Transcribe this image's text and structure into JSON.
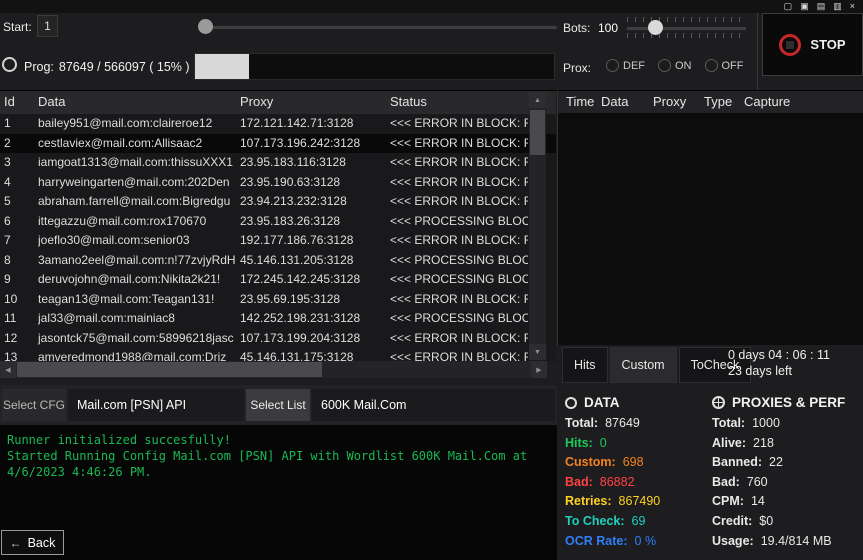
{
  "titlebar": {
    "icons": [
      {
        "name": "window-icon-1",
        "glyph": "▢"
      },
      {
        "name": "window-icon-2",
        "glyph": "▣"
      },
      {
        "name": "window-icon-3",
        "glyph": "▤"
      },
      {
        "name": "window-icon-4",
        "glyph": "▥"
      },
      {
        "name": "close-icon",
        "glyph": "×"
      }
    ]
  },
  "icons": {
    "scroll_up": "▲",
    "scroll_down": "▼",
    "scroll_left": "◀",
    "scroll_right": "▶",
    "back_arrow": "←"
  },
  "controls": {
    "start_label": "Start:",
    "start_value": "1",
    "bots_label": "Bots:",
    "bots_value": "100",
    "prog_label": "Prog:",
    "prog_value": "87649 / 566097  ( 15% )",
    "prog_percent": 15,
    "prox_label": "Prox:",
    "prox_options": [
      "DEF",
      "ON",
      "OFF"
    ],
    "stop_label": "STOP",
    "stop_accent_color": "#c62828"
  },
  "results_table": {
    "columns": [
      "Id",
      "Data",
      "Proxy",
      "Status"
    ],
    "rows": [
      {
        "id": "1",
        "data": "bailey951@mail.com:claireroe12",
        "proxy": "172.121.142.71:3128",
        "status": "<<< ERROR IN BLOCK: R",
        "selected": false
      },
      {
        "id": "2",
        "data": "cestlaviex@mail.com:Allisaac2",
        "proxy": "107.173.196.242:3128",
        "status": "<<< ERROR IN BLOCK: R",
        "selected": true
      },
      {
        "id": "3",
        "data": "iamgoat1313@mail.com:thissuXXX1",
        "proxy": "23.95.183.116:3128",
        "status": "<<< ERROR IN BLOCK: R",
        "selected": false
      },
      {
        "id": "4",
        "data": "harryweingarten@mail.com:202Den",
        "proxy": "23.95.190.63:3128",
        "status": "<<< ERROR IN BLOCK: R",
        "selected": false
      },
      {
        "id": "5",
        "data": "abraham.farrell@mail.com:Bigredgu",
        "proxy": "23.94.213.232:3128",
        "status": "<<< ERROR IN BLOCK: R",
        "selected": false
      },
      {
        "id": "6",
        "data": "ittegazzu@mail.com:rox170670",
        "proxy": "23.95.183.26:3128",
        "status": "<<< PROCESSING BLOCK",
        "selected": false
      },
      {
        "id": "7",
        "data": "joeflo30@mail.com:senior03",
        "proxy": "192.177.186.76:3128",
        "status": "<<< ERROR IN BLOCK: R",
        "selected": false
      },
      {
        "id": "8",
        "data": "3amano2eel@mail.com:n!77zvjyRdH",
        "proxy": "45.146.131.205:3128",
        "status": "<<< PROCESSING BLOCK",
        "selected": false
      },
      {
        "id": "9",
        "data": "deruvojohn@mail.com:Nikita2k21!",
        "proxy": "172.245.142.245:3128",
        "status": "<<< PROCESSING BLOCK",
        "selected": false
      },
      {
        "id": "10",
        "data": "teagan13@mail.com:Teagan131!",
        "proxy": "23.95.69.195:3128",
        "status": "<<< ERROR IN BLOCK: R",
        "selected": false
      },
      {
        "id": "11",
        "data": "jal33@mail.com:mainiac8",
        "proxy": "142.252.198.231:3128",
        "status": "<<< PROCESSING BLOCK",
        "selected": false
      },
      {
        "id": "12",
        "data": "jasontck75@mail.com:58996218jasc",
        "proxy": "107.173.199.204:3128",
        "status": "<<< ERROR IN BLOCK: R",
        "selected": false
      },
      {
        "id": "13",
        "data": "amveredmond1988@mail.com:Driz",
        "proxy": "45.146.131.175:3128",
        "status": "<<< ERROR IN BLOCK: R",
        "selected": false
      }
    ]
  },
  "hits_table": {
    "columns": [
      "Time",
      "Data",
      "Proxy",
      "Type",
      "Capture"
    ]
  },
  "tabs": {
    "items": [
      "Hits",
      "Custom",
      "ToCheck"
    ],
    "active": "Custom",
    "timer": "0 days 04 : 06 : 11",
    "days_left": "23 days left"
  },
  "config": {
    "select_cfg_label": "Select CFG",
    "config_value": "Mail.com [PSN] API",
    "select_list_label": "Select List",
    "wordlist_value": "600K Mail.Com"
  },
  "log": {
    "color": "#19b852",
    "lines": [
      "Runner initialized succesfully!",
      "Started Running Config Mail.com [PSN] API with Wordlist 600K Mail.Com at",
      "4/6/2023 4:46:26 PM."
    ]
  },
  "back_button": {
    "label": "Back"
  },
  "data_panel": {
    "title": "DATA",
    "stats": [
      {
        "label": "Total:",
        "value": "87649",
        "color": "#e8e8e8"
      },
      {
        "label": "Hits:",
        "value": "0",
        "color": "#1ec95b"
      },
      {
        "label": "Custom:",
        "value": "698",
        "color": "#f5821f"
      },
      {
        "label": "Bad:",
        "value": "86882",
        "color": "#ff4343"
      },
      {
        "label": "Retries:",
        "value": "867490",
        "color": "#ffd21e"
      },
      {
        "label": "To Check:",
        "value": "69",
        "color": "#1fd0be"
      },
      {
        "label": "OCR Rate:",
        "value": "0 %",
        "color": "#2f7ef7"
      }
    ]
  },
  "proxies_panel": {
    "title": "PROXIES & PERF",
    "stats": [
      {
        "label": "Total:",
        "value": "1000",
        "color": "#e8e8e8"
      },
      {
        "label": "Alive:",
        "value": "218",
        "color": "#e8e8e8"
      },
      {
        "label": "Banned:",
        "value": "22",
        "color": "#e8e8e8"
      },
      {
        "label": "Bad:",
        "value": "760",
        "color": "#e8e8e8"
      },
      {
        "label": "CPM:",
        "value": "14",
        "color": "#e8e8e8"
      },
      {
        "label": "Credit:",
        "value": "$0",
        "color": "#e8e8e8"
      },
      {
        "label": "Usage:",
        "value": "19.4/814 MB",
        "color": "#e8e8e8"
      }
    ]
  }
}
